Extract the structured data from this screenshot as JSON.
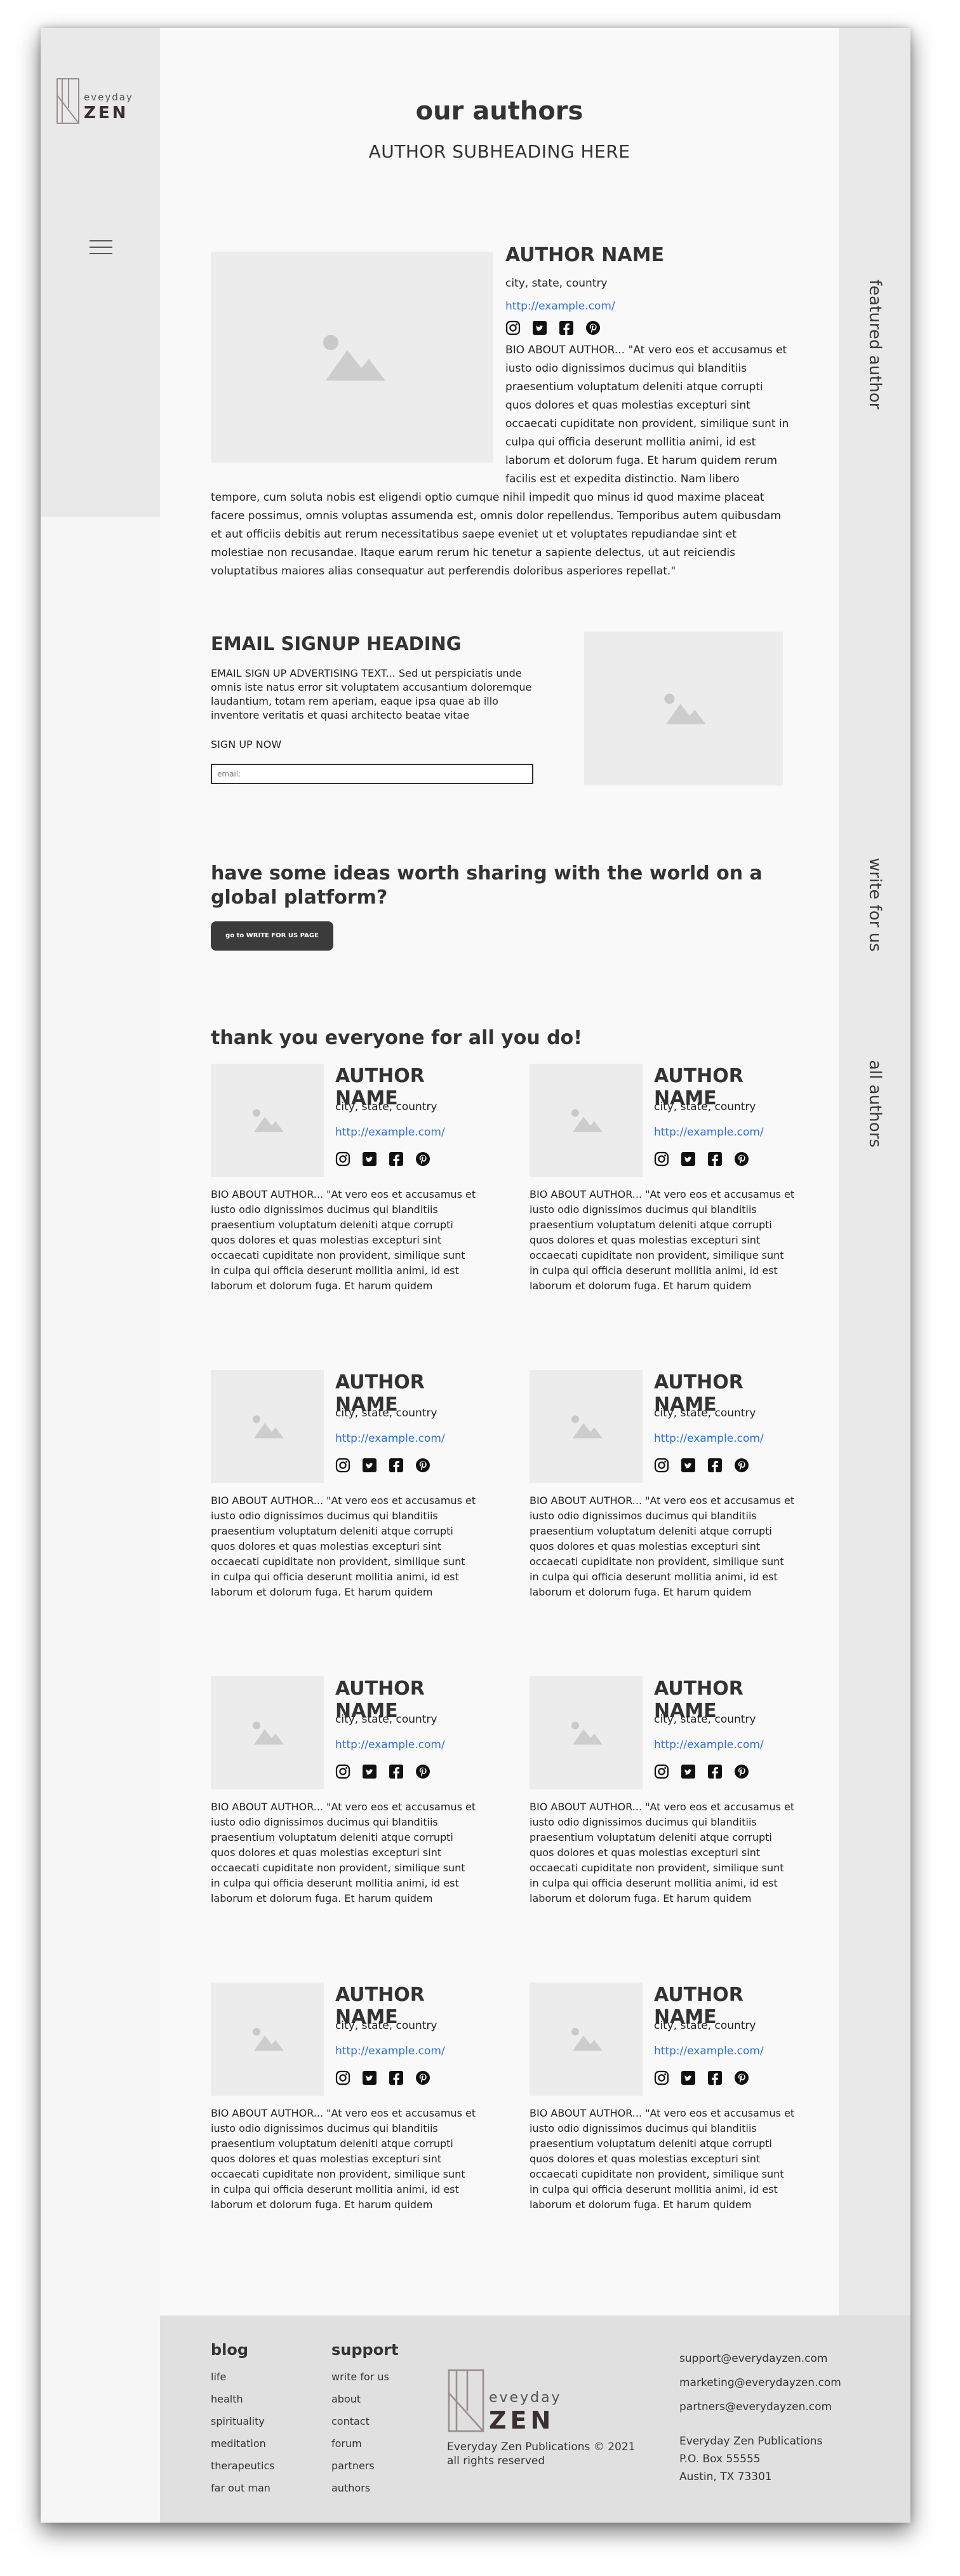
{
  "brand": {
    "word_top": "eveyday",
    "word_bottom": "ZEN"
  },
  "page": {
    "title": "our authors",
    "subtitle": "AUTHOR SUBHEADING HERE"
  },
  "rail": {
    "featured": "featured author",
    "write": "write for us",
    "all": "all authors"
  },
  "featured": {
    "name": "AUTHOR NAME",
    "location": "city, state, country",
    "url": "http://example.com/",
    "bio": "BIO ABOUT AUTHOR... \"At vero eos et accusamus et iusto odio dignissimos ducimus qui blanditiis praesentium voluptatum deleniti atque corrupti quos dolores et quas molestias excepturi sint occaecati cupiditate non provident, similique sunt in culpa qui officia deserunt mollitia animi, id est laborum et dolorum fuga. Et harum quidem rerum facilis est et expedita distinctio. Nam libero tempore, cum soluta nobis est eligendi optio cumque nihil impedit quo minus id quod maxime placeat facere possimus, omnis voluptas assumenda est, omnis dolor repellendus. Temporibus autem quibusdam et aut officiis debitis aut rerum necessitatibus saepe eveniet ut et voluptates repudiandae sint et molestiae non recusandae. Itaque earum rerum hic tenetur a sapiente delectus, ut aut reiciendis voluptatibus maiores alias consequatur aut perferendis doloribus asperiores repellat.\""
  },
  "signup": {
    "heading": "EMAIL SIGNUP HEADING",
    "text": "EMAIL SIGN UP ADVERTISING TEXT... Sed ut perspiciatis unde omnis iste natus error sit voluptatem accusantium doloremque laudantium, totam rem aperiam, eaque ipsa quae ab illo inventore veritatis et quasi architecto beatae vitae",
    "cta": "SIGN UP NOW",
    "placeholder": "email:"
  },
  "write": {
    "heading": "have some ideas worth sharing with the world on a global platform?",
    "button": "go to WRITE FOR US PAGE"
  },
  "authors": {
    "heading": "thank you everyone for all you do!",
    "name": "AUTHOR NAME",
    "location": "city, state, country",
    "url": "http://example.com/",
    "bio": "BIO ABOUT AUTHOR... \"At vero eos et accusamus et iusto odio dignissimos ducimus qui blanditiis praesentium voluptatum deleniti atque corrupti quos dolores et quas molestias excepturi sint occaecati cupiditate non provident, similique sunt in culpa qui officia deserunt mollitia animi, id est laborum et dolorum fuga. Et harum quidem"
  },
  "social_icons": [
    "instagram-icon",
    "twitter-icon",
    "facebook-icon",
    "pinterest-icon"
  ],
  "footer": {
    "blog": {
      "heading": "blog",
      "items": [
        "life",
        "health",
        "spirituality",
        "meditation",
        "therapeutics",
        "far out man"
      ]
    },
    "support": {
      "heading": "support",
      "items": [
        "write for us",
        "about",
        "contact",
        "forum",
        "partners",
        "authors"
      ]
    },
    "copyright": "Everyday Zen Publications © 2021",
    "rights": "all rights reserved",
    "emails": [
      "support@everydayzen.com",
      "marketing@everydayzen.com",
      "partners@everydayzen.com"
    ],
    "address": [
      "Everyday Zen Publications",
      "P.O. Box 55555",
      "Austin, TX 73301"
    ]
  },
  "colors": {
    "link": "#2b6fd6",
    "button": "#3b3b3b",
    "sidebar": "#e9e9e9",
    "footer": "#e0e0e0"
  }
}
